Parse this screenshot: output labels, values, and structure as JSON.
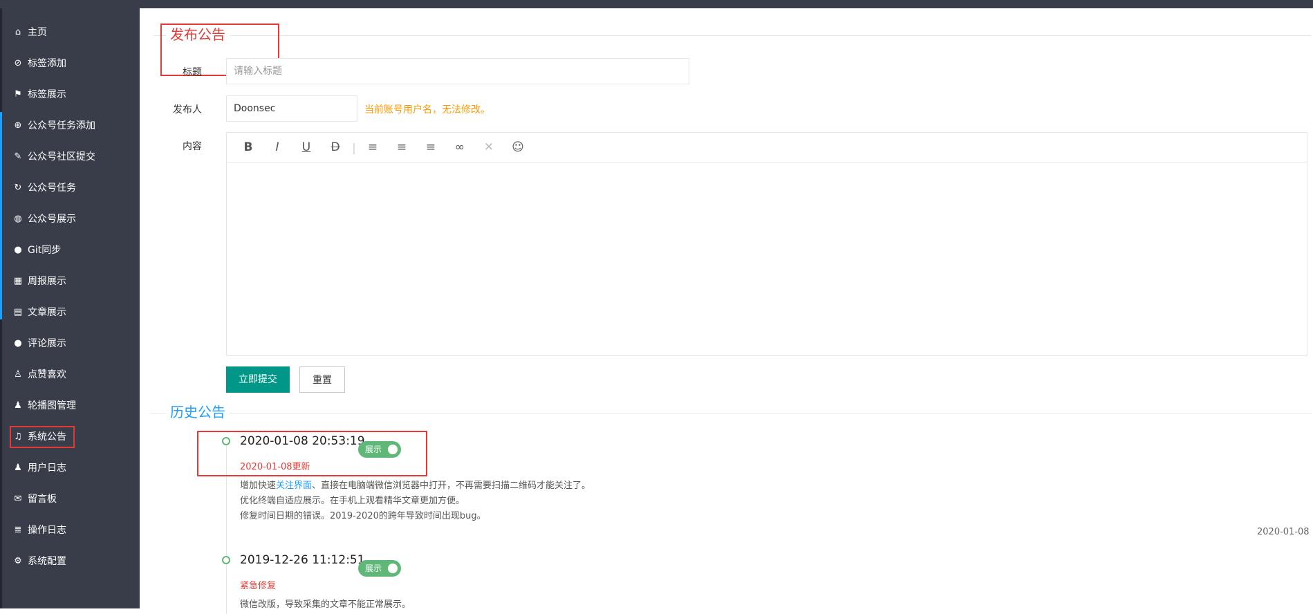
{
  "sidebar": {
    "items": [
      {
        "label": "主页",
        "icon": "home-icon",
        "glyph": "⌂"
      },
      {
        "label": "标签添加",
        "icon": "tag-icon",
        "glyph": "⊘"
      },
      {
        "label": "标签展示",
        "icon": "flag-icon",
        "glyph": "⚑"
      },
      {
        "label": "公众号任务添加",
        "icon": "plus-circle-icon",
        "glyph": "⊕"
      },
      {
        "label": "公众号社区提交",
        "icon": "edit-doc-icon",
        "glyph": "✎"
      },
      {
        "label": "公众号任务",
        "icon": "refresh-icon",
        "glyph": "↻"
      },
      {
        "label": "公众号展示",
        "icon": "chat-circle-icon",
        "glyph": "◍"
      },
      {
        "label": "Git同步",
        "icon": "github-icon",
        "glyph": "●"
      },
      {
        "label": "周报展示",
        "icon": "calendar-grid-icon",
        "glyph": "▦"
      },
      {
        "label": "文章展示",
        "icon": "book-icon",
        "glyph": "▤"
      },
      {
        "label": "评论展示",
        "icon": "comment-icon",
        "glyph": "●"
      },
      {
        "label": "点赞喜欢",
        "icon": "thumbs-up-icon",
        "glyph": "♙"
      },
      {
        "label": "轮播图管理",
        "icon": "users-icon",
        "glyph": "♟"
      },
      {
        "label": "系统公告",
        "icon": "bell-icon",
        "glyph": "♫"
      },
      {
        "label": "用户日志",
        "icon": "user-group-icon",
        "glyph": "♟"
      },
      {
        "label": "留言板",
        "icon": "message-board-icon",
        "glyph": "✉"
      },
      {
        "label": "操作日志",
        "icon": "database-icon",
        "glyph": "≣"
      },
      {
        "label": "系统配置",
        "icon": "gear-icon",
        "glyph": "⚙"
      }
    ],
    "active_label": "系统公告"
  },
  "form": {
    "legend": "发布公告",
    "title_label": "标题",
    "title_placeholder": "请输入标题",
    "author_label": "发布人",
    "author_value": "Doonsec",
    "author_hint": "当前账号用户名，无法修改。",
    "content_label": "内容",
    "toolbar": [
      {
        "name": "bold-icon",
        "glyph": "B"
      },
      {
        "name": "italic-icon",
        "glyph": "I"
      },
      {
        "name": "underline-icon",
        "glyph": "U"
      },
      {
        "name": "strikethrough-icon",
        "glyph": "D"
      },
      {
        "name": "separator",
        "glyph": "|"
      },
      {
        "name": "align-left-icon",
        "glyph": "≡"
      },
      {
        "name": "align-center-icon",
        "glyph": "≡"
      },
      {
        "name": "align-right-icon",
        "glyph": "≡"
      },
      {
        "name": "link-icon",
        "glyph": "∞"
      },
      {
        "name": "unlink-icon",
        "glyph": "✕"
      },
      {
        "name": "emoji-icon",
        "glyph": "☺"
      }
    ],
    "submit_label": "立即提交",
    "reset_label": "重置"
  },
  "history": {
    "legend": "历史公告",
    "entries": [
      {
        "datetime": "2020-01-08 20:53:19",
        "switch_label": "展示",
        "subtitle": "2020-01-08更新",
        "line1_pre": "增加快速",
        "line1_link": "关注界面",
        "line1_post": "、直接在电脑端微信浏览器中打开，不再需要扫描二维码才能关注了。",
        "line2": "优化终端自适应展示。在手机上观看精华文章更加方便。",
        "line3": "修复时间日期的错误。2019-2020的跨年导致时间出现bug。",
        "footer_date": "2020-01-08"
      },
      {
        "datetime": "2019-12-26 11:12:51",
        "switch_label": "展示",
        "subtitle": "紧急修复",
        "line1": "微信改版，导致采集的文章不能正常展示。"
      }
    ]
  },
  "colors": {
    "sidebar_bg": "#393d49",
    "primary": "#009688",
    "accent_blue": "#1e9fff",
    "alert_red": "#e53935",
    "hint_orange": "#ff9800",
    "switch_green": "#5fb878"
  }
}
